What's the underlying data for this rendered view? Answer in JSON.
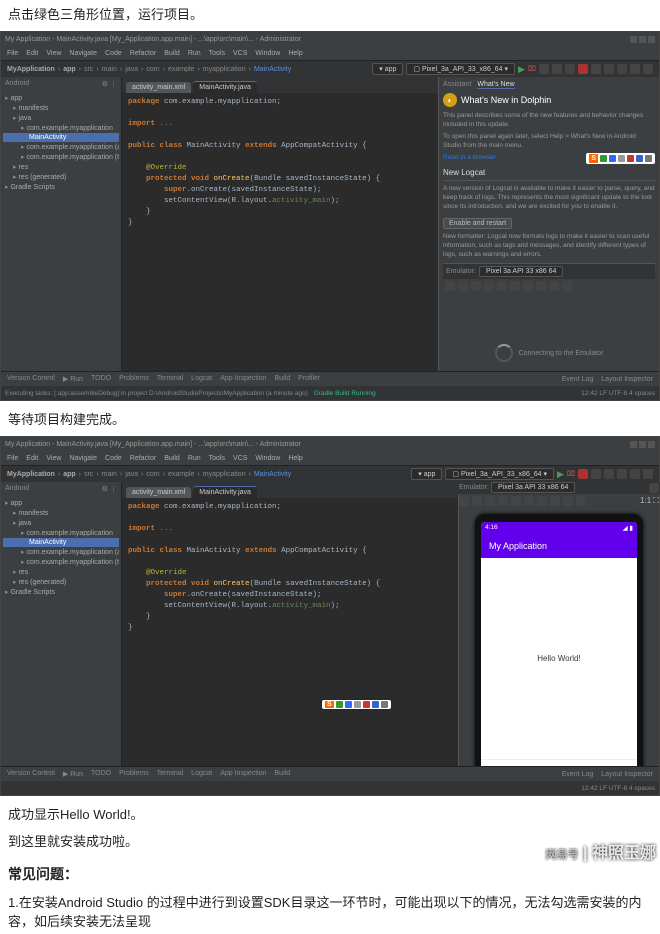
{
  "captions": {
    "c1": "点击绿色三角形位置，运行项目。",
    "c2": "等待项目构建完成。",
    "c3": "成功显示Hello World!。",
    "c4": "到这里就安装成功啦。",
    "faq_title": "常见问题：",
    "faq1": "1.在安装Android Studio 的过程中进行到设置SDK目录这一环节时，可能出现以下的情况，无法勾选需安装的内容，如后续安装无法呈现"
  },
  "title": "My Application - MainActivity.java [My_Application.app.main] - ...\\app\\src\\main\\... - Administrator",
  "menu": [
    "File",
    "Edit",
    "View",
    "Navigate",
    "Code",
    "Refactor",
    "Build",
    "Run",
    "Tools",
    "VCS",
    "Window",
    "Help"
  ],
  "crumbs": [
    "MyApplication",
    "app",
    "src",
    "main",
    "java",
    "com",
    "example",
    "myapplication",
    "MainActivity"
  ],
  "device_select": "Pixel_3a_API_33_x86_64",
  "run_config": "app",
  "project_label": "Android",
  "tree": [
    {
      "t": "app",
      "d": 0,
      "c": "folder"
    },
    {
      "t": "manifests",
      "d": 1,
      "c": "folder"
    },
    {
      "t": "java",
      "d": 1,
      "c": "folder"
    },
    {
      "t": "com.example.myapplication",
      "d": 2,
      "c": "folder"
    },
    {
      "t": "MainActivity",
      "d": 3,
      "c": "file fj",
      "sel": true
    },
    {
      "t": "com.example.myapplication (androidTest)",
      "d": 2,
      "c": "folder"
    },
    {
      "t": "com.example.myapplication (test)",
      "d": 2,
      "c": "folder"
    },
    {
      "t": "res",
      "d": 1,
      "c": "folder"
    },
    {
      "t": "res (generated)",
      "d": 1,
      "c": "folder"
    },
    {
      "t": "Gradle Scripts",
      "d": 0,
      "c": "folder"
    }
  ],
  "tabs": [
    {
      "label": "activity_main.xml",
      "active": false
    },
    {
      "label": "MainActivity.java",
      "active": true
    }
  ],
  "code_lines": {
    "l1": "package com.example.myapplication;",
    "l2": "",
    "l3": "import ...",
    "l4": "",
    "l5": "public class MainActivity extends AppCompatActivity {",
    "l6": "",
    "l7": "    @Override",
    "l8": "    protected void onCreate(Bundle savedInstanceState) {",
    "l9": "        super.onCreate(savedInstanceState);",
    "l10": "        setContentView(R.layout.activity_main);",
    "l11": "    }",
    "l12": "}"
  },
  "assistant": {
    "tab1": "Assistant",
    "tab2": "What's New",
    "heading": "What's New in Dolphin",
    "p1": "This panel describes some of the new features and behavior changes included in this update.",
    "p2": "To open this panel again later, select Help > What's New in Android Studio from the main menu.",
    "link": "Read in a browser",
    "sub": "New Logcat",
    "p3": "A new version of Logcat is available to make it easier to parse, query, and keep track of logs. This represents the most significant update to the tool since its introduction, and we are excited for you to enable it.",
    "btn": "Enable and restart",
    "p4": "New formatter: Logcat now formats logs to make it easier to scan useful information, such as tags and messages, and identify different types of logs, such as warnings and errors."
  },
  "emu": {
    "title": "Emulator:",
    "device": "Pixel 3a API 33 x86 64",
    "connecting": "Connecting to the Emulator"
  },
  "phone": {
    "time": "4:16",
    "app_title": "My Application",
    "hello": "Hello World!"
  },
  "bottom_tabs": [
    "Version Control",
    "Run",
    "TODO",
    "Problems",
    "Terminal",
    "Logcat",
    "App Inspection",
    "Build",
    "Profiler"
  ],
  "bottom_right": [
    "Event Log",
    "Layout Inspector"
  ],
  "status": {
    "left_a": "Executing tasks: [:app:assembleDebug] in project D:\\AndroidStudioProjects\\MyApplication (a minute ago)",
    "left_b": "",
    "right": "12:42   LF   UTF-8   4 spaces"
  },
  "build_running": "Gradle Build Running",
  "watermark_small": "网易号",
  "watermark": "神照玉娜"
}
